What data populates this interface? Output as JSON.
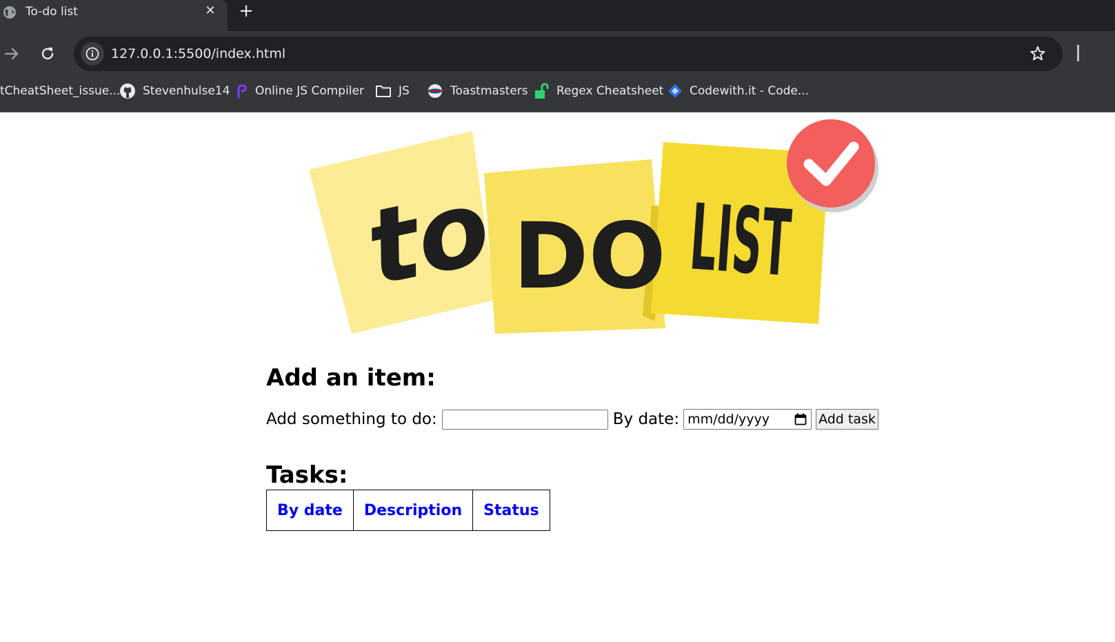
{
  "browser": {
    "tab_title": "To-do list",
    "tab_close": "✕",
    "new_tab": "+",
    "url": "127.0.0.1:5500/index.html",
    "bookmarks": [
      {
        "label": "tCheatSheet_issue...",
        "icon": "none"
      },
      {
        "label": "Stevenhulse14",
        "icon": "github-icon"
      },
      {
        "label": "Online JS Compiler",
        "icon": "programiz-icon"
      },
      {
        "label": "JS",
        "icon": "folder-icon"
      },
      {
        "label": "Toastmasters",
        "icon": "toastmasters-icon"
      },
      {
        "label": "Regex Cheatsheet",
        "icon": "lock-icon"
      },
      {
        "label": "Codewith.it - Code...",
        "icon": "diamond-icon"
      }
    ]
  },
  "logo": {
    "word1": "to",
    "word2": "DO",
    "word3": "LIST",
    "colors": {
      "note1": "#fbec95",
      "note2": "#f8e15e",
      "note3": "#f5da32",
      "check": "#f25f5c"
    }
  },
  "add_section": {
    "heading": "Add an item:",
    "todo_label": "Add something to do:",
    "todo_value": "",
    "date_label": "By date:",
    "date_placeholder": "mm/dd/yyyy",
    "add_button": "Add task"
  },
  "tasks_section": {
    "heading": "Tasks:",
    "columns": [
      "By date",
      "Description",
      "Status"
    ]
  }
}
